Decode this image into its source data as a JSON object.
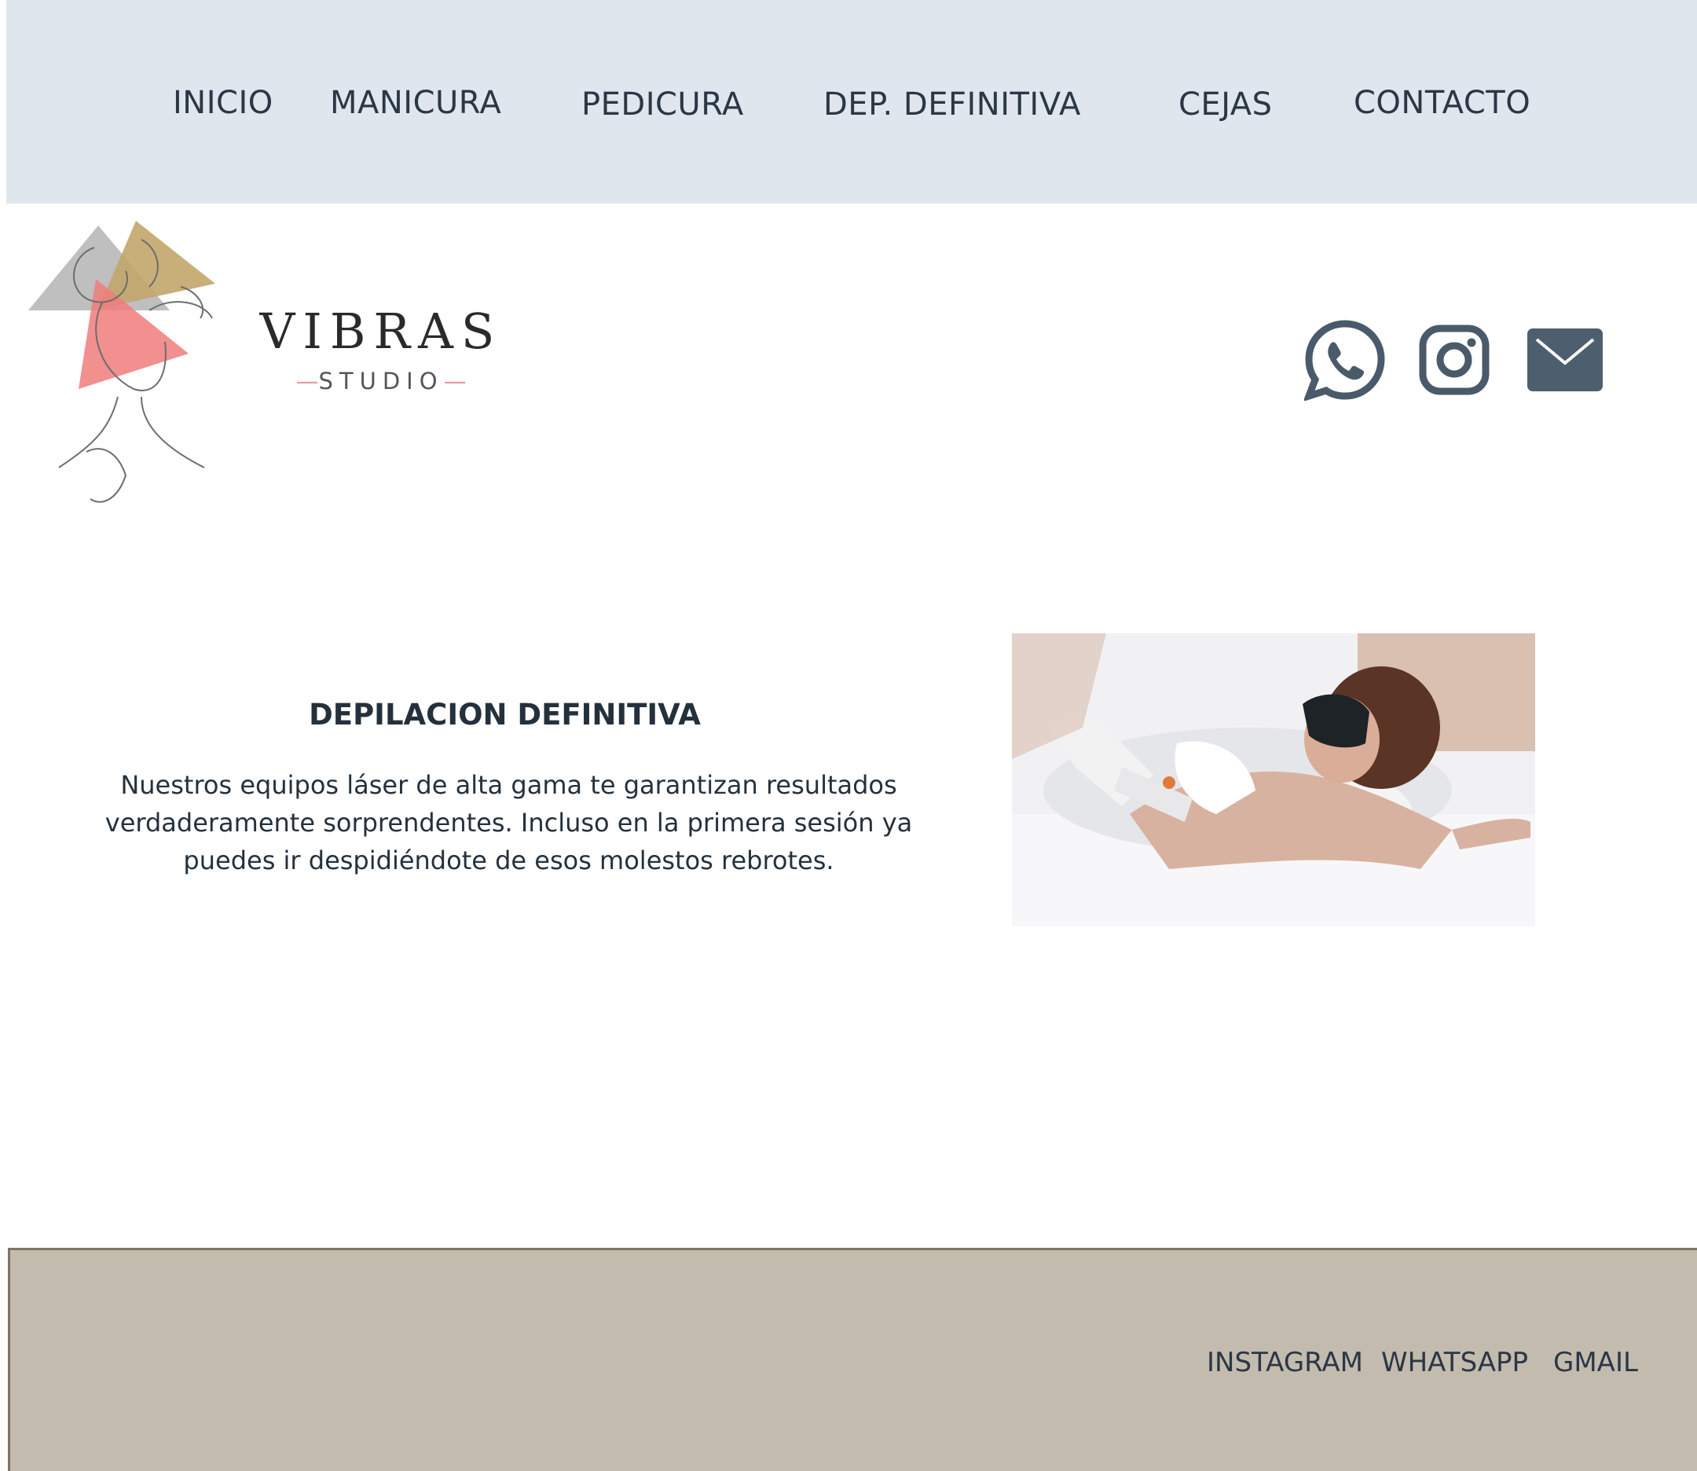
{
  "nav": {
    "items": [
      "INICIO",
      "MANICURA",
      "PEDICURA",
      "DEP. DEFINITIVA",
      "CEJAS",
      "CONTACTO"
    ]
  },
  "logo": {
    "word": "VIBRAS",
    "sub": "STUDIO"
  },
  "social": {
    "icons": [
      "whatsapp-icon",
      "instagram-icon",
      "mail-icon"
    ]
  },
  "content": {
    "title": "DEPILACION DEFINITIVA",
    "text": "Nuestros equipos láser de alta gama te garantizan resultados verdaderamente sorprendentes. Incluso en la primera sesión ya puedes ir despidiéndote de esos molestos rebrotes."
  },
  "footer": {
    "links": [
      "INSTAGRAM",
      "WHATSAPP",
      "GMAIL"
    ]
  },
  "colors": {
    "nav_bg": "#dfe6ee",
    "text": "#24313d",
    "icon": "#4a5a6a",
    "footer_bg": "#c3bbae"
  }
}
